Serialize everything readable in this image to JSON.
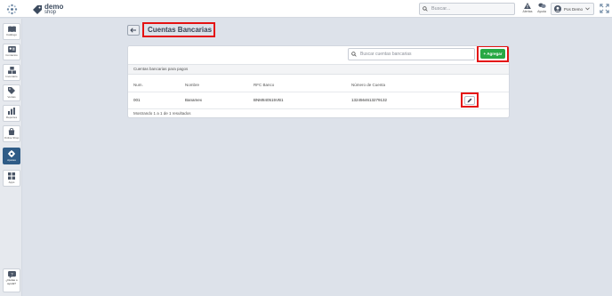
{
  "brand": {
    "line1": "demo",
    "line2": "shop"
  },
  "topbar": {
    "search_placeholder": "Buscar...",
    "alerts_label": "Alertas",
    "help_label": "Ayuda",
    "user_name": "Pos Demo"
  },
  "sidebar": {
    "items": [
      {
        "label": "Catálogo",
        "icon": "book-icon"
      },
      {
        "label": "Contactos",
        "icon": "contacts-icon"
      },
      {
        "label": "Inventario",
        "icon": "boxes-icon"
      },
      {
        "label": "Ventas",
        "icon": "tag-icon"
      },
      {
        "label": "Reportes",
        "icon": "bar-chart-icon"
      },
      {
        "label": "Online Shop",
        "icon": "shop-icon"
      },
      {
        "label": "Ajustes",
        "icon": "gear-icon",
        "active": true
      },
      {
        "label": "Apps",
        "icon": "grid-icon"
      }
    ],
    "help_line1": "¿Dudas o",
    "help_line2": "ayuda?"
  },
  "page": {
    "title": "Cuentas Bancarias",
    "search_placeholder": "Buscar cuentas bancarias",
    "add_label": "+ Agregar",
    "subheader": "Cuentas bancarias para pagos",
    "columns": [
      "Num.",
      "Nombre",
      "RFC Banco",
      "Número de Cuenta"
    ],
    "rows": [
      [
        "001",
        "Banamex",
        "BNM840515VB1",
        "1324564613279132"
      ]
    ],
    "footer": "Mostrando 1 a 1 de 1 resultados"
  },
  "colors": {
    "accent_green": "#27a844",
    "highlight_red": "#e41212",
    "active_nav": "#2f5c87"
  }
}
